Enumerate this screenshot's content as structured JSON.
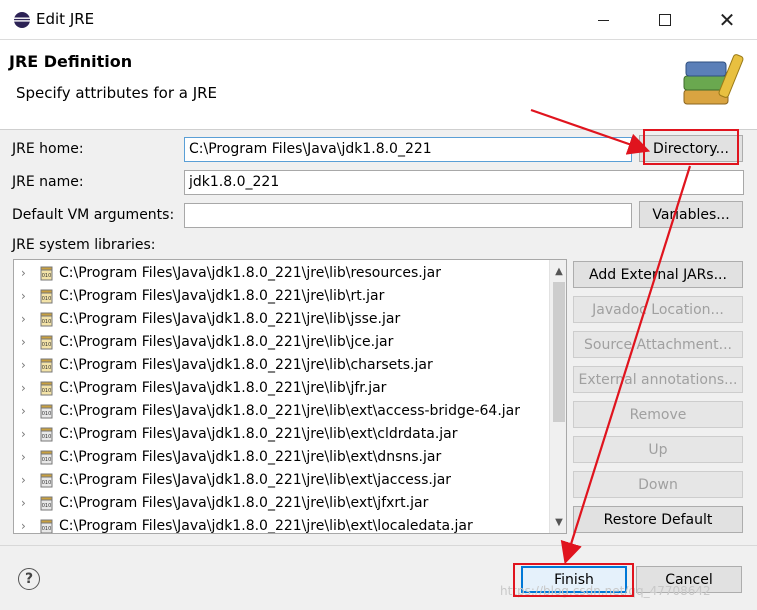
{
  "window": {
    "title": "Edit JRE"
  },
  "header": {
    "title": "JRE Definition",
    "subtitle": "Specify attributes for a JRE"
  },
  "form": {
    "jre_home_label": "JRE home:",
    "jre_home_value": "C:\\Program Files\\Java\\jdk1.8.0_221",
    "directory_button": "Directory...",
    "jre_name_label": "JRE name:",
    "jre_name_value": "jdk1.8.0_221",
    "vm_args_label": "Default VM arguments:",
    "vm_args_value": "",
    "variables_button": "Variables...",
    "libraries_label": "JRE system libraries:"
  },
  "libraries": [
    "C:\\Program Files\\Java\\jdk1.8.0_221\\jre\\lib\\resources.jar",
    "C:\\Program Files\\Java\\jdk1.8.0_221\\jre\\lib\\rt.jar",
    "C:\\Program Files\\Java\\jdk1.8.0_221\\jre\\lib\\jsse.jar",
    "C:\\Program Files\\Java\\jdk1.8.0_221\\jre\\lib\\jce.jar",
    "C:\\Program Files\\Java\\jdk1.8.0_221\\jre\\lib\\charsets.jar",
    "C:\\Program Files\\Java\\jdk1.8.0_221\\jre\\lib\\jfr.jar",
    "C:\\Program Files\\Java\\jdk1.8.0_221\\jre\\lib\\ext\\access-bridge-64.jar",
    "C:\\Program Files\\Java\\jdk1.8.0_221\\jre\\lib\\ext\\cldrdata.jar",
    "C:\\Program Files\\Java\\jdk1.8.0_221\\jre\\lib\\ext\\dnsns.jar",
    "C:\\Program Files\\Java\\jdk1.8.0_221\\jre\\lib\\ext\\jaccess.jar",
    "C:\\Program Files\\Java\\jdk1.8.0_221\\jre\\lib\\ext\\jfxrt.jar",
    "C:\\Program Files\\Java\\jdk1.8.0_221\\jre\\lib\\ext\\localedata.jar"
  ],
  "side_buttons": {
    "add_external": "Add External JARs...",
    "javadoc": "Javadoc Location...",
    "source": "Source Attachment...",
    "annotations": "External annotations...",
    "remove": "Remove",
    "up": "Up",
    "down": "Down",
    "restore": "Restore Default"
  },
  "footer": {
    "finish": "Finish",
    "cancel": "Cancel",
    "help_glyph": "?"
  },
  "watermark": "https://blog.csdn.net/qq_47708642",
  "colors": {
    "annotation_red": "#e0141e",
    "focus_blue": "#0078d7"
  }
}
